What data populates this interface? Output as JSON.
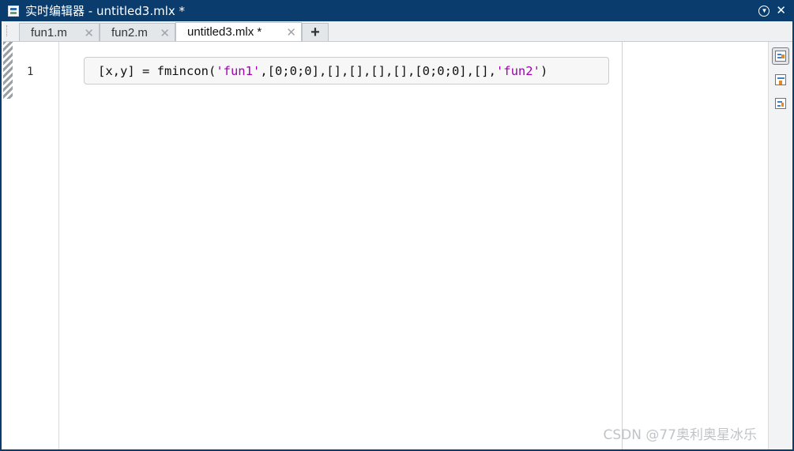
{
  "window": {
    "title": "实时编辑器 - untitled3.mlx *"
  },
  "tabs": [
    {
      "label": "fun1.m",
      "active": false
    },
    {
      "label": "fun2.m",
      "active": false
    },
    {
      "label": "untitled3.mlx *",
      "active": true
    }
  ],
  "tab_add_label": "+",
  "tab_close_glyph": "✕",
  "editor": {
    "line_number": "1",
    "code": {
      "prefix": "[x,y] = fmincon(",
      "arg1": "'fun1'",
      "middle": ",[0;0;0],[],[],[],[],[0;0;0],[],",
      "arg2": "'fun2'",
      "suffix": ")"
    }
  },
  "right_panel": {
    "buttons": [
      {
        "icon": "output-on-right-icon",
        "selected": true
      },
      {
        "icon": "output-inline-icon",
        "selected": false
      },
      {
        "icon": "hide-code-icon",
        "selected": false
      }
    ]
  },
  "watermark": "CSDN @77奥利奥星冰乐",
  "colors": {
    "titlebar": "#0a3d6e",
    "string_literal": "#a000b0"
  }
}
